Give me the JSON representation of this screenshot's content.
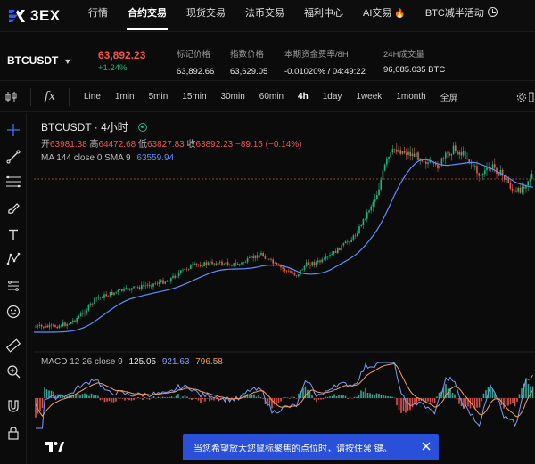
{
  "nav": {
    "logo_text": "3EX",
    "items": [
      {
        "label": "行情",
        "active": false
      },
      {
        "label": "合约交易",
        "active": true
      },
      {
        "label": "现货交易",
        "active": false
      },
      {
        "label": "法币交易",
        "active": false
      },
      {
        "label": "福利中心",
        "active": false
      },
      {
        "label": "AI交易",
        "active": false
      },
      {
        "label": "BTC减半活动",
        "active": false
      }
    ]
  },
  "ticker": {
    "symbol": "BTCUSDT",
    "last_price": "63,892.23",
    "change_pct": "+1.24%",
    "stats": [
      {
        "label": "标记价格",
        "value": "63,892.66"
      },
      {
        "label": "指数价格",
        "value": "63,629.05"
      },
      {
        "label": "本期资金费率/8H",
        "value": "-0.01020% / 04:49:22"
      },
      {
        "label": "24H成交量",
        "value": "96,085.035 BTC"
      }
    ]
  },
  "toolbar": {
    "timeframes": [
      "Line",
      "1min",
      "5min",
      "15min",
      "30min",
      "60min",
      "4h",
      "1day",
      "1week",
      "1month",
      "全屏"
    ],
    "active_timeframe": "4h",
    "fx_label": "fx"
  },
  "legend": {
    "title": "BTCUSDT · 4小时",
    "ohlc": {
      "open_label": "开",
      "open": "63981.38",
      "high_label": "高",
      "high": "64472.68",
      "low_label": "低",
      "low": "63827.83",
      "close_label": "收",
      "close": "63892.23",
      "change": "−89.15 (−0.14%)"
    },
    "ma_label": "MA 144 close 0 SMA 9",
    "ma_value": "63559.94",
    "macd_label": "MACD 12 26 close 9",
    "macd_hist": "125.05",
    "macd_line": "921.63",
    "macd_signal": "796.58"
  },
  "toast": {
    "text": "当您希望放大您鼠标聚焦的点位时，请按住⌘ 键。"
  },
  "colors": {
    "up": "#19b87c",
    "down": "#f0564a",
    "ma": "#5b8ff9",
    "macd_line": "#7d9bf5",
    "macd_signal": "#f0a05e",
    "toast_bg": "#2a4fd8"
  }
}
